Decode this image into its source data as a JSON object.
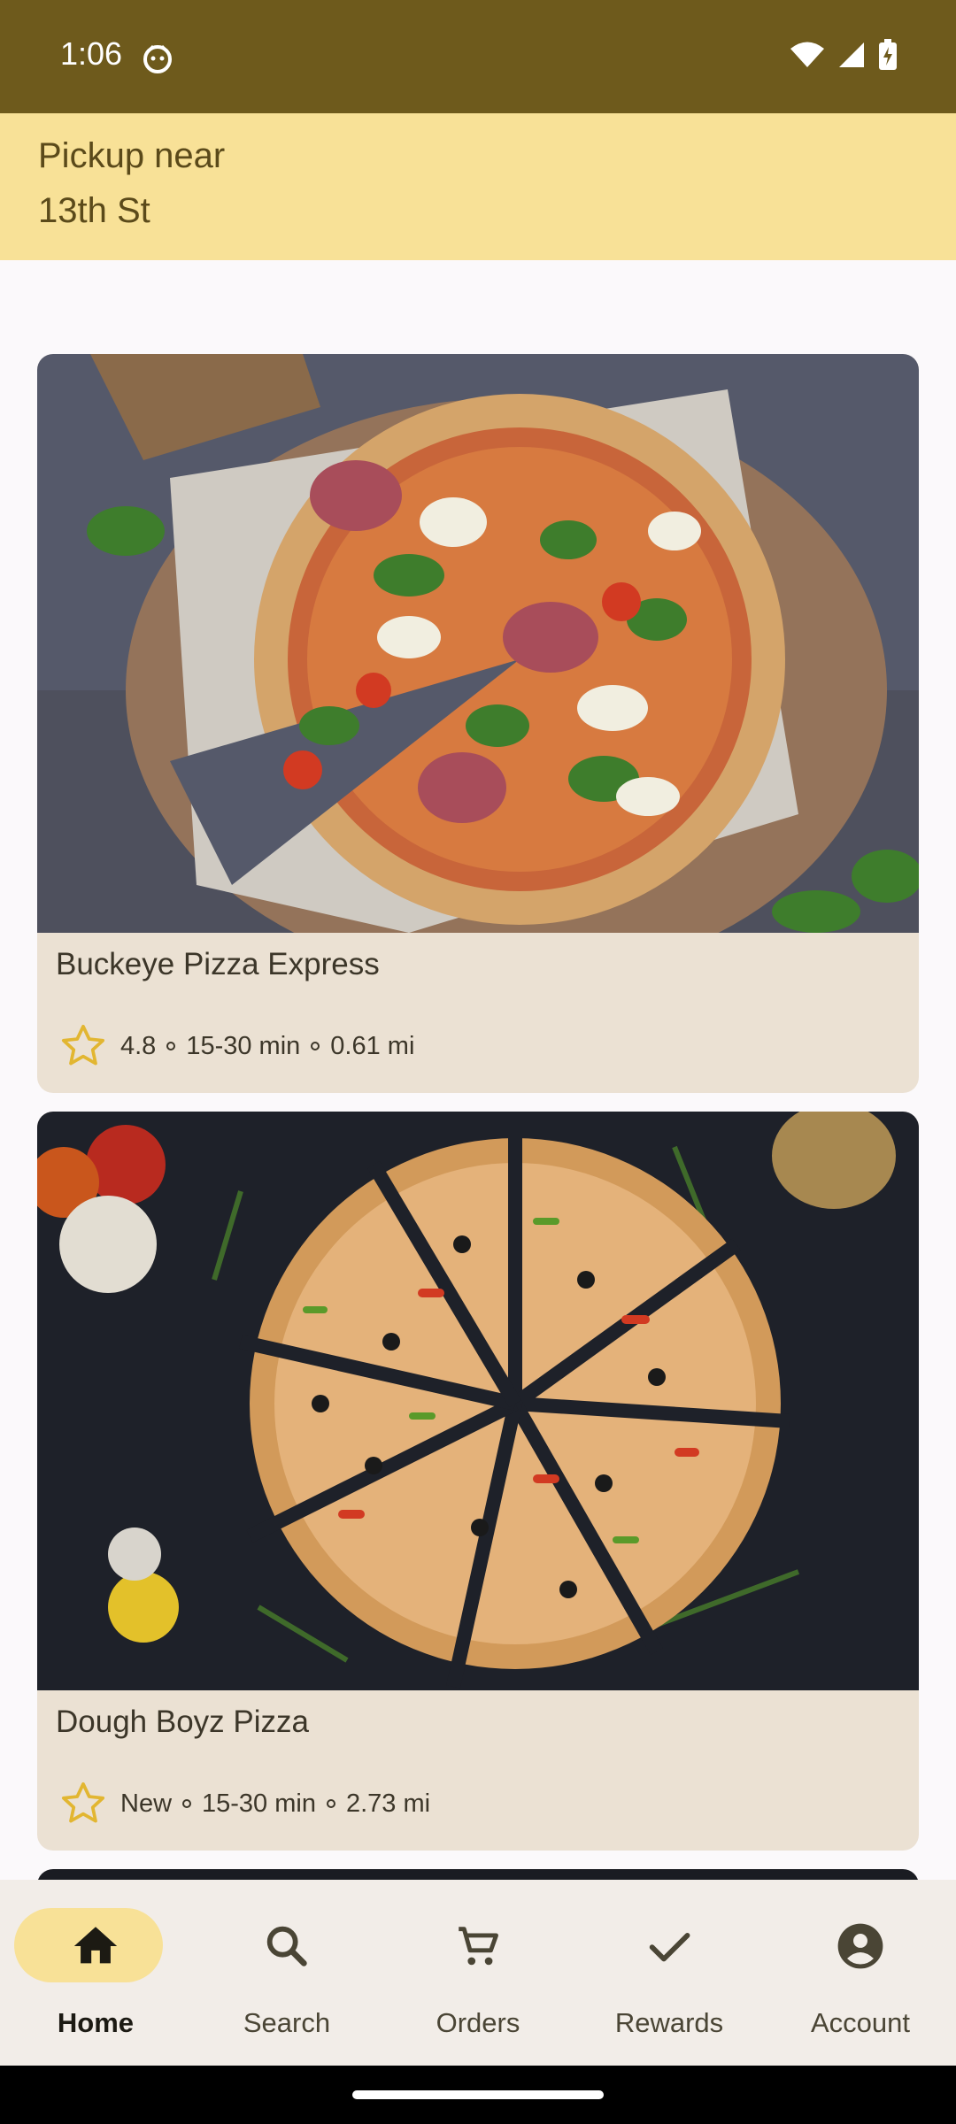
{
  "status_bar": {
    "time": "1:06"
  },
  "header": {
    "line1": "Pickup near",
    "line2": "13th St"
  },
  "restaurants": [
    {
      "name": "Buckeye Pizza Express",
      "rating": "4.8",
      "time": "15-30 min",
      "distance": "0.61 mi",
      "photo": "pizza-photo"
    },
    {
      "name": "Dough Boyz Pizza",
      "rating": "New",
      "time": "15-30 min",
      "distance": "2.73 mi",
      "photo": "pizza-photo"
    }
  ],
  "nav": [
    {
      "label": "Home",
      "icon": "home-icon",
      "active": true
    },
    {
      "label": "Search",
      "icon": "search-icon",
      "active": false
    },
    {
      "label": "Orders",
      "icon": "cart-icon",
      "active": false
    },
    {
      "label": "Rewards",
      "icon": "check-icon",
      "active": false
    },
    {
      "label": "Account",
      "icon": "account-icon",
      "active": false
    }
  ],
  "colors": {
    "status_bar": "#6e5a1c",
    "header": "#f8e197",
    "card": "#ebe1d3",
    "nav_active_pill": "#f8e197",
    "star": "#e2b631"
  }
}
